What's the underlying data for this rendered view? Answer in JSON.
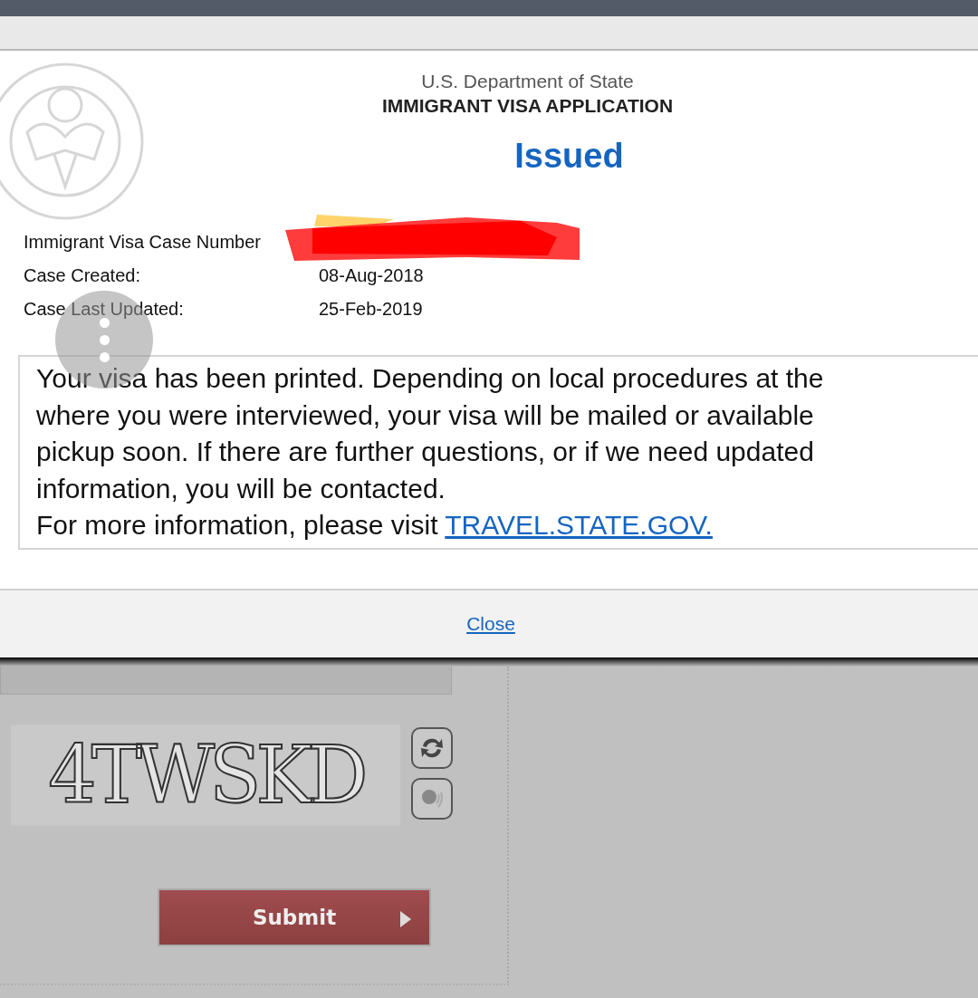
{
  "dialog": {
    "agency": "U.S. Department of State",
    "title": "IMMIGRANT VISA APPLICATION",
    "status": "Issued",
    "fields": [
      {
        "label": "Immigrant Visa Case Number",
        "value_redacted": true
      },
      {
        "label": "Case Created:",
        "value": "08-Aug-2018",
        "value_redacted": false
      },
      {
        "label": "Case Last Updated:",
        "value": "25-Feb-2019",
        "value_redacted": false
      }
    ],
    "message": {
      "lines": [
        "Your visa has been printed. Depending on local procedures at the",
        "where you were interviewed, your visa will be mailed or available",
        "pickup soon. If there are further questions, or if we need updated",
        "information, you will be contacted."
      ],
      "link_intro": "For more information, please visit ",
      "link": "TRAVEL.STATE.GOV."
    },
    "close": "Close"
  },
  "form": {
    "captcha": "4TWSKD",
    "submit": "Submit"
  }
}
